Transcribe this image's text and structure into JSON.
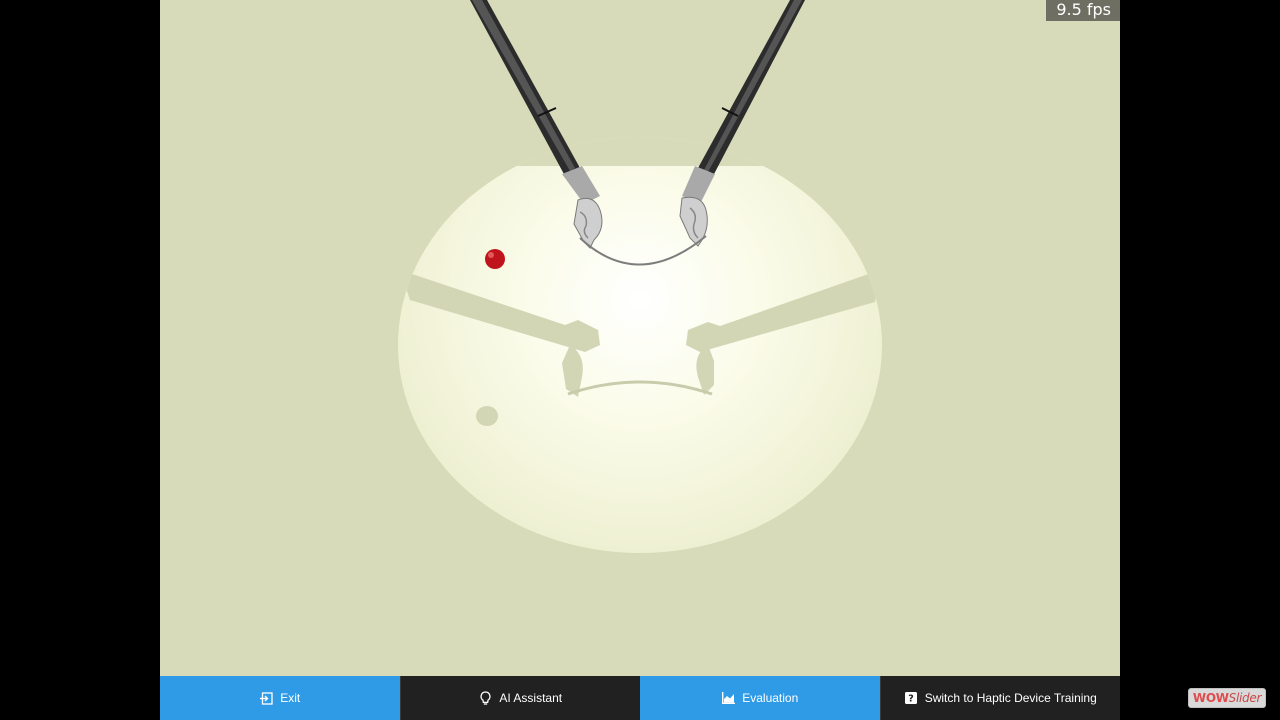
{
  "viewport": {
    "fps_label": "9.5 fps",
    "background_color": "#d7dbb9",
    "marker_color": "#c0141c"
  },
  "toolbar": {
    "buttons": [
      {
        "label": "Exit",
        "icon": "exit-icon",
        "style": "primary"
      },
      {
        "label": "AI Assistant",
        "icon": "lightbulb-icon",
        "style": "dark"
      },
      {
        "label": "Evaluation",
        "icon": "chart-icon",
        "style": "primary"
      },
      {
        "label": "Switch to Haptic Device Training",
        "icon": "help-icon",
        "style": "dark"
      }
    ]
  },
  "watermark": {
    "part1": "WOW",
    "part2": "Slider"
  }
}
